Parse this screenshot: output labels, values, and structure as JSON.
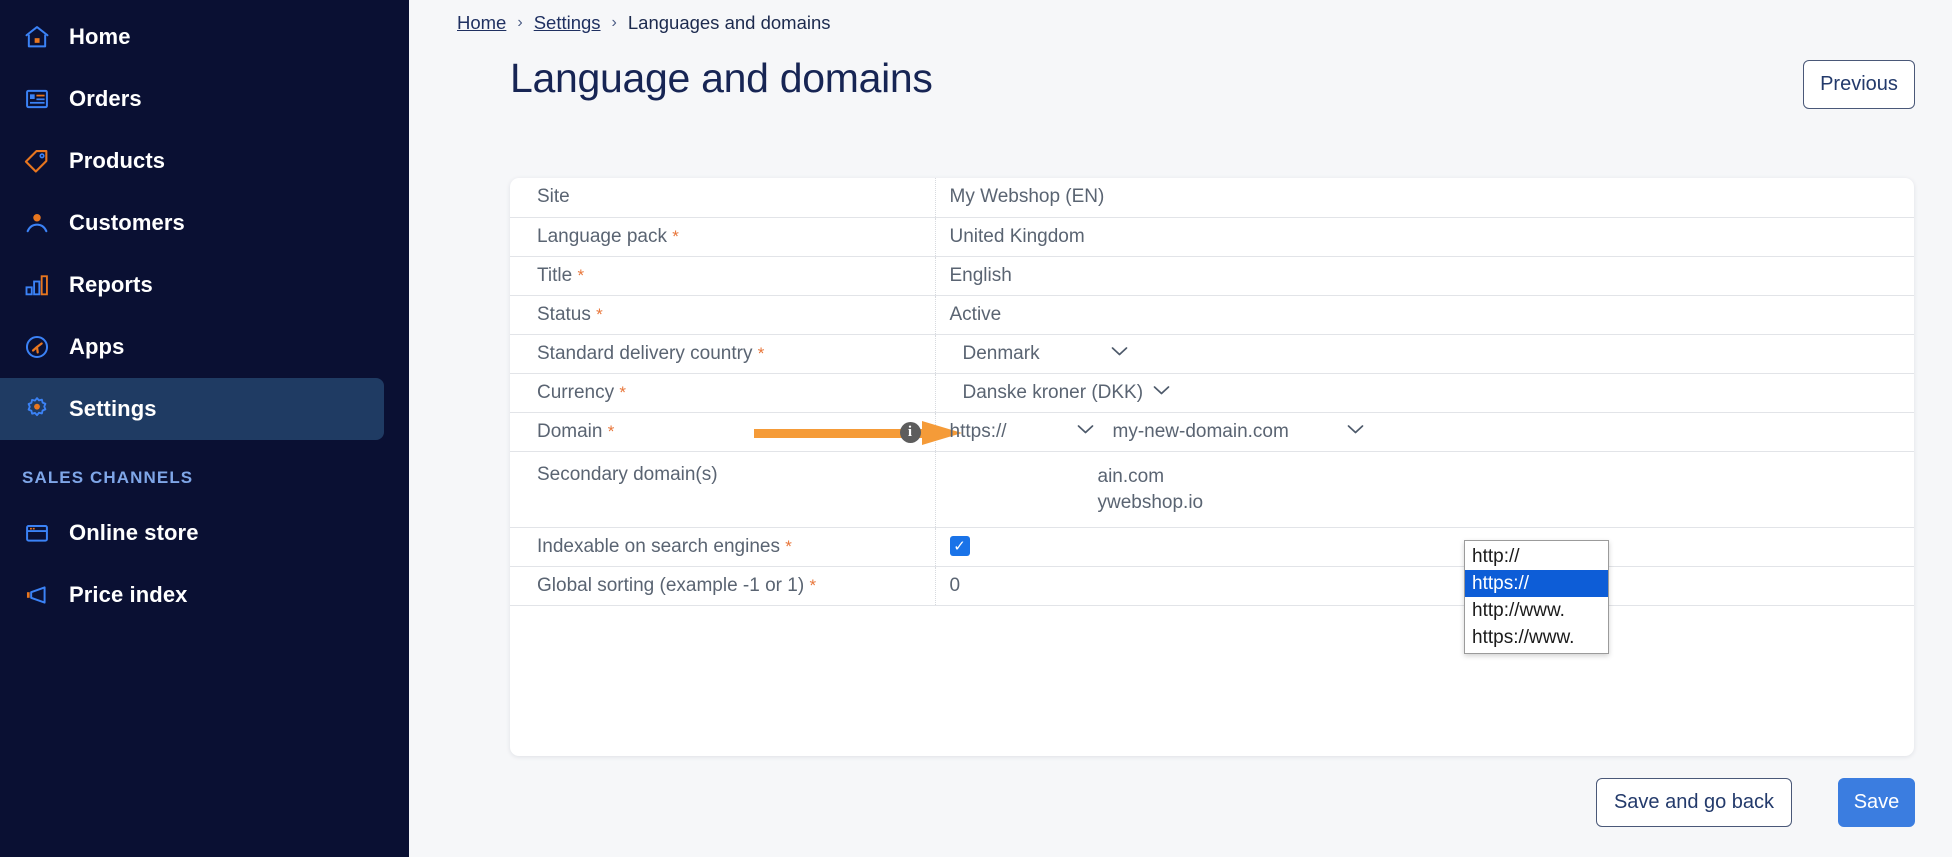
{
  "sidebar": {
    "items": [
      {
        "label": "Home",
        "icon": "home-icon",
        "active": false
      },
      {
        "label": "Orders",
        "icon": "orders-icon",
        "active": false
      },
      {
        "label": "Products",
        "icon": "tag-icon",
        "active": false
      },
      {
        "label": "Customers",
        "icon": "user-icon",
        "active": false
      },
      {
        "label": "Reports",
        "icon": "bar-chart-icon",
        "active": false
      },
      {
        "label": "Apps",
        "icon": "apps-icon",
        "active": false
      },
      {
        "label": "Settings",
        "icon": "gear-icon",
        "active": true
      }
    ],
    "section_label": "SALES CHANNELS",
    "channels": [
      {
        "label": "Online store",
        "icon": "store-icon"
      },
      {
        "label": "Price index",
        "icon": "megaphone-icon"
      }
    ],
    "bg_color": "#0a1033",
    "active_color": "#1f3b63",
    "accent_color": "#e8761f"
  },
  "breadcrumb": {
    "home": "Home",
    "settings": "Settings",
    "current": "Languages and domains",
    "separator": "›"
  },
  "header": {
    "title": "Language and domains",
    "previous_label": "Previous"
  },
  "form": {
    "rows": [
      {
        "label": "Site",
        "required": false,
        "value": "My Webshop (EN)",
        "type": "text"
      },
      {
        "label": "Language pack",
        "required": true,
        "value": "United Kingdom",
        "type": "text"
      },
      {
        "label": "Title",
        "required": true,
        "value": "English",
        "type": "text"
      },
      {
        "label": "Status",
        "required": true,
        "value": "Active",
        "type": "text"
      },
      {
        "label": "Standard delivery country",
        "required": true,
        "value": "Denmark",
        "type": "select"
      },
      {
        "label": "Currency",
        "required": true,
        "value": "Danske kroner (DKK)",
        "type": "select"
      },
      {
        "label": "Domain",
        "required": true,
        "value": "",
        "type": "domain"
      },
      {
        "label": "Secondary domain(s)",
        "required": false,
        "value": "",
        "type": "secondary"
      },
      {
        "label": "Indexable on search engines",
        "required": true,
        "value": "",
        "type": "checkbox"
      },
      {
        "label": "Global sorting (example -1 or 1)",
        "required": true,
        "value": "0",
        "type": "text"
      }
    ],
    "required_marker": "*",
    "chevron": "⌄"
  },
  "domain_row": {
    "protocol_value": "https://",
    "domain_value": "my-new-domain.com",
    "info_icon_char": "i",
    "annotation": "orange-arrow-pointing-to-info-icon"
  },
  "secondary_domains": [
    {
      "suffix": "ain.com"
    },
    {
      "suffix": "ywebshop.io"
    }
  ],
  "indexable": {
    "checked": true,
    "check_char": "✓"
  },
  "protocol_dropdown": {
    "open": true,
    "options": [
      {
        "label": "http://",
        "selected": false
      },
      {
        "label": "https://",
        "selected": true
      },
      {
        "label": "http://www.",
        "selected": false
      },
      {
        "label": "https://www.",
        "selected": false
      }
    ],
    "highlight_color": "#0d5dd7"
  },
  "footer": {
    "save_and_go_back_label": "Save and go back",
    "save_label": "Save",
    "save_color": "#3b7de0"
  }
}
